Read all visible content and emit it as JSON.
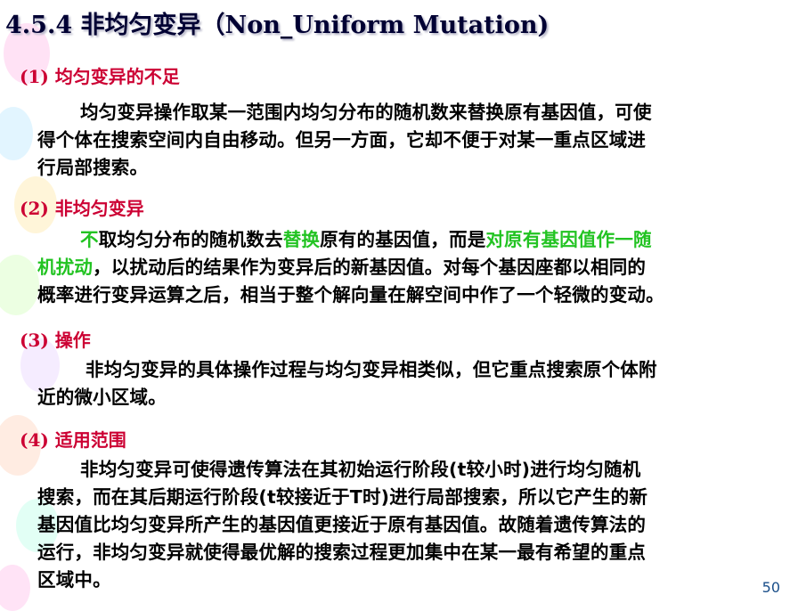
{
  "slide": {
    "title": "4.5.4  非均匀变异（Non_Uniform Mutation)",
    "page_number": "50",
    "accent_color": "#cc0033",
    "highlight_color": "#22c322"
  },
  "sections": [
    {
      "heading": "(1) 均匀变异的不足",
      "lines": [
        "均匀变异操作取某一范围内均匀分布的随机数来替换原有基因值，可使",
        "得个体在搜索空间内自由移动。但另一方面，它却不便于对某一重点区域进",
        "行局部搜索。"
      ]
    },
    {
      "heading": "(2) 非均匀变异",
      "line1": {
        "seg1": "不",
        "seg2": "取均匀分布的随机数去",
        "seg3": "替换",
        "seg4": "原有的基因值，而是",
        "seg5": "对原有基因值作一随"
      },
      "line2": {
        "seg1": "机扰动",
        "seg2": "，以扰动后的结果作为变异后的新基因值。对每个基因座都以相同的"
      },
      "line3": "概率进行变异运算之后，相当于整个解向量在解空间中作了一个轻微的变动。"
    },
    {
      "heading": "(3)  操作",
      "lines": [
        "非均匀变异的具体操作过程与均匀变异相类似，但它重点搜索原个体附",
        "近的微小区域。"
      ]
    },
    {
      "heading": "(4) 适用范围",
      "lines": [
        "非均匀变异可使得遗传算法在其初始运行阶段(t较小时)进行均匀随机",
        "搜索，而在其后期运行阶段(t较接近于T时)进行局部搜索，所以它产生的新",
        "基因值比均匀变异所产生的基因值更接近于原有基因值。故随着遗传算法的",
        "运行，非均匀变异就使得最优解的搜索过程更加集中在某一最有希望的重点",
        "区域中。"
      ]
    }
  ]
}
